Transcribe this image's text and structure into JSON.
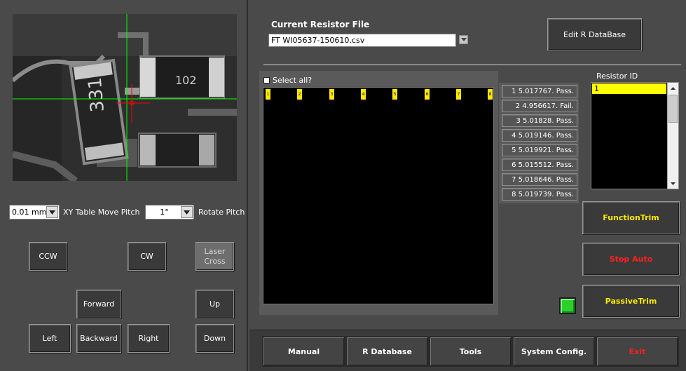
{
  "camera": {
    "label_331": "331",
    "label_102": "102"
  },
  "controls": {
    "pitch_value": "0.01 mm",
    "pitch_label": "XY Table Move Pitch",
    "rotate_value": "1°",
    "rotate_label": "Rotate Pitch"
  },
  "motion_buttons": {
    "ccw": "CCW",
    "cw": "CW",
    "laser_cross_line1": "Laser",
    "laser_cross_line2": "Cross",
    "forward": "Forward",
    "up": "Up",
    "left": "Left",
    "backward": "Backward",
    "right": "Right",
    "down": "Down"
  },
  "resistor_file": {
    "title": "Current Resistor File",
    "value": "FT WI05637-150610.csv"
  },
  "edit_db_button": "Edit R DataBase",
  "grid": {
    "select_all_label": "Select all?",
    "pins": [
      "1",
      "2",
      "3",
      "4",
      "5",
      "6",
      "7",
      "8"
    ]
  },
  "results": [
    "1 5.017767. Pass.",
    "2 4.956617. Fail.",
    "3 5.01828. Pass.",
    "4 5.019146. Pass.",
    "5 5.019921. Pass.",
    "6 5.015512. Pass.",
    "7 5.018646. Pass.",
    "8 5.019739. Pass."
  ],
  "resistor_id": {
    "label": "Resistor ID",
    "selected": "1"
  },
  "actions": {
    "function_trim": "FunctionTrim",
    "stop_auto": "Stop Auto",
    "passive_trim": "PassiveTrim"
  },
  "nav": {
    "manual": "Manual",
    "r_database": "R Database",
    "tools": "Tools",
    "system_config": "System Config.",
    "exit": "Exit"
  },
  "colors": {
    "accent_yellow": "#ffea00",
    "danger_red": "#ff2020",
    "status_green": "#2bd12b",
    "crosshair_green": "#00ff00",
    "crosshair_red": "#ff0000"
  }
}
